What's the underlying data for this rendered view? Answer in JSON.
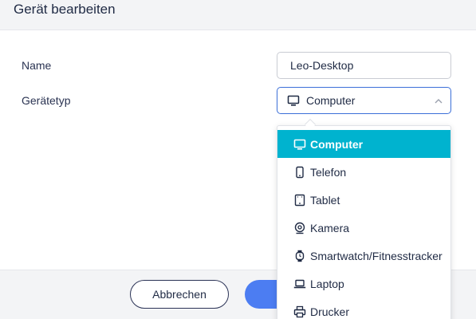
{
  "dialog": {
    "title": "Gerät bearbeiten"
  },
  "form": {
    "name_label": "Name",
    "name_value": "Leo-Desktop",
    "type_label": "Gerätetyp",
    "type_value": "Computer",
    "type_icon": "monitor-icon"
  },
  "dropdown": {
    "options": [
      {
        "label": "Computer",
        "icon": "monitor-icon",
        "selected": true
      },
      {
        "label": "Telefon",
        "icon": "phone-icon",
        "selected": false
      },
      {
        "label": "Tablet",
        "icon": "tablet-icon",
        "selected": false
      },
      {
        "label": "Kamera",
        "icon": "camera-icon",
        "selected": false
      },
      {
        "label": "Smartwatch/Fitnesstracker",
        "icon": "watch-icon",
        "selected": false
      },
      {
        "label": "Laptop",
        "icon": "laptop-icon",
        "selected": false
      },
      {
        "label": "Drucker",
        "icon": "printer-icon",
        "selected": false
      }
    ]
  },
  "footer": {
    "cancel_label": "Abbrechen"
  },
  "colors": {
    "accent": "#4c7df2",
    "selected_option": "#00b3cf",
    "focus_border": "#3b6fd8"
  }
}
